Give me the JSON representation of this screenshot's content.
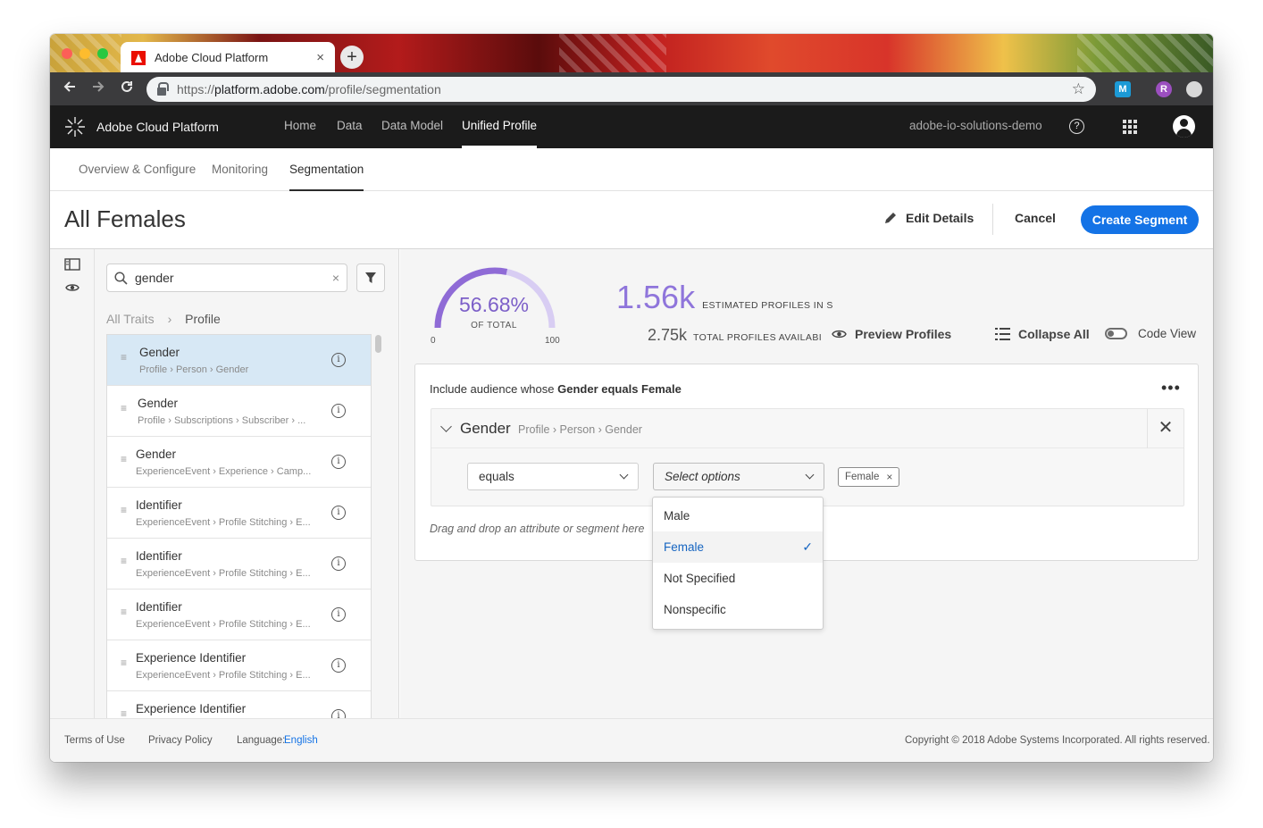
{
  "browser": {
    "tab_title": "Adobe Cloud Platform",
    "tab_close": "×",
    "new_tab": "+",
    "url_scheme": "https://",
    "url_host": "platform.adobe.com",
    "url_path": "/profile/segmentation",
    "ext_m": "M",
    "ext_r": "R"
  },
  "app": {
    "brand": "Adobe Cloud Platform",
    "nav": [
      {
        "label": "Home"
      },
      {
        "label": "Data"
      },
      {
        "label": "Data Model"
      },
      {
        "label": "Unified Profile",
        "active": true
      }
    ],
    "org": "adobe-io-solutions-demo",
    "help": "?"
  },
  "subnav": [
    {
      "label": "Overview & Configure"
    },
    {
      "label": "Monitoring"
    },
    {
      "label": "Segmentation",
      "active": true
    }
  ],
  "header": {
    "title": "All Females",
    "edit_label": "Edit Details",
    "cancel_label": "Cancel",
    "create_label": "Create Segment"
  },
  "left": {
    "search_value": "gender",
    "search_clear": "×",
    "breadcrumb_root": "All Traits",
    "breadcrumb_sep": "›",
    "breadcrumb_current": "Profile",
    "items": [
      {
        "name": "Gender",
        "path": "Profile › Person › Gender",
        "selected": true
      },
      {
        "name": "Gender",
        "path": "Profile › Subscriptions › Subscriber › ..."
      },
      {
        "name": "Gender",
        "path": "ExperienceEvent › Experience › Camp..."
      },
      {
        "name": "Identifier",
        "path": "ExperienceEvent › Profile Stitching › E..."
      },
      {
        "name": "Identifier",
        "path": "ExperienceEvent › Profile Stitching › E..."
      },
      {
        "name": "Identifier",
        "path": "ExperienceEvent › Profile Stitching › E..."
      },
      {
        "name": "Experience Identifier",
        "path": "ExperienceEvent › Profile Stitching › E..."
      },
      {
        "name": "Experience Identifier",
        "path": ""
      }
    ],
    "info_glyph": "i"
  },
  "stats": {
    "percent_label": "56.68%",
    "percent_value": 56.68,
    "of_total": "OF TOTAL",
    "gauge_min": "0",
    "gauge_max": "100",
    "estimated": "1.56k",
    "estimated_label": "ESTIMATED PROFILES IN S",
    "total": "2.75k",
    "total_label": "TOTAL PROFILES AVAILABI",
    "preview_label": "Preview Profiles",
    "collapse_label": "Collapse All",
    "codeview_label": "Code View"
  },
  "rule": {
    "prefix": "Include audience whose ",
    "summary": "Gender equals Female",
    "more": "•••",
    "attribute": "Gender",
    "path": "Profile › Person › Gender",
    "close": "✕",
    "operator": "equals",
    "value_placeholder": "Select options",
    "selected_tag": "Female",
    "tag_remove": "×",
    "drop_hint": "Drag and drop an attribute or segment here"
  },
  "dropdown": {
    "options": [
      {
        "label": "Male"
      },
      {
        "label": "Female",
        "selected": true
      },
      {
        "label": "Not Specified"
      },
      {
        "label": "Nonspecific"
      }
    ],
    "check": "✓"
  },
  "footer": {
    "terms": "Terms of Use",
    "privacy": "Privacy Policy",
    "language_label": "Language:",
    "language_value": "English",
    "copyright": "Copyright ©  2018 Adobe Systems Incorporated.  All rights reserved."
  },
  "colors": {
    "accent": "#1473e6",
    "gauge": "#8f75db",
    "appbar": "#1b1b1b",
    "selected_row": "#d7e8f5"
  }
}
